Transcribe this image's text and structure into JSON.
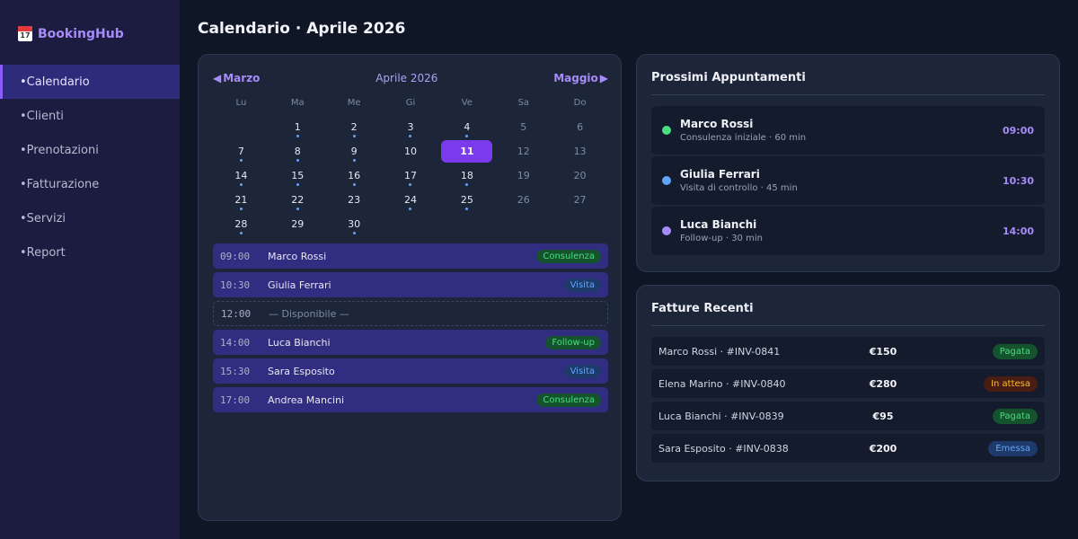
{
  "brand": {
    "name": "BookingHub",
    "icon": "calendar-icon",
    "icon_number": "17"
  },
  "sidebar": {
    "items": [
      {
        "label": "Calendario",
        "active": true
      },
      {
        "label": "Clienti",
        "active": false
      },
      {
        "label": "Prenotazioni",
        "active": false
      },
      {
        "label": "Fatturazione",
        "active": false
      },
      {
        "label": "Servizi",
        "active": false
      },
      {
        "label": "Report",
        "active": false
      }
    ]
  },
  "page": {
    "title": "Calendario · Aprile 2026"
  },
  "calendar": {
    "prev_label": "Marzo",
    "current_label": "Aprile 2026",
    "next_label": "Maggio",
    "weekdays": [
      "Lu",
      "Ma",
      "Me",
      "Gi",
      "Ve",
      "Sa",
      "Do"
    ],
    "today": 11,
    "weeks": [
      [
        null,
        1,
        2,
        3,
        4,
        5,
        6
      ],
      [
        7,
        8,
        9,
        10,
        11,
        12,
        13
      ],
      [
        14,
        15,
        16,
        17,
        18,
        19,
        20
      ],
      [
        21,
        22,
        23,
        24,
        25,
        26,
        27
      ],
      [
        28,
        29,
        30,
        null,
        null,
        null,
        null
      ]
    ],
    "days_with_events": [
      1,
      2,
      3,
      4,
      7,
      8,
      9,
      14,
      15,
      16,
      17,
      18,
      21,
      22,
      24,
      25,
      28,
      30
    ]
  },
  "slots": [
    {
      "time": "09:00",
      "name": "Marco Rossi",
      "tag": "Consulenza",
      "tag_color": "green"
    },
    {
      "time": "10:30",
      "name": "Giulia Ferrari",
      "tag": "Visita",
      "tag_color": "blue"
    },
    {
      "time": "12:00",
      "name": "— Disponibile —",
      "tag": null,
      "free": true
    },
    {
      "time": "14:00",
      "name": "Luca Bianchi",
      "tag": "Follow-up",
      "tag_color": "green"
    },
    {
      "time": "15:30",
      "name": "Sara Esposito",
      "tag": "Visita",
      "tag_color": "blue"
    },
    {
      "time": "17:00",
      "name": "Andrea Mancini",
      "tag": "Consulenza",
      "tag_color": "green"
    }
  ],
  "appointments": {
    "title": "Prossimi Appuntamenti",
    "items": [
      {
        "name": "Marco Rossi",
        "desc": "Consulenza iniziale · 60 min",
        "time": "09:00",
        "dot_color": "#4ade80"
      },
      {
        "name": "Giulia Ferrari",
        "desc": "Visita di controllo · 45 min",
        "time": "10:30",
        "dot_color": "#60a5fa"
      },
      {
        "name": "Luca Bianchi",
        "desc": "Follow-up · 30 min",
        "time": "14:00",
        "dot_color": "#a78bfa"
      }
    ]
  },
  "invoices": {
    "title": "Fatture Recenti",
    "items": [
      {
        "client": "Marco Rossi · #INV-0841",
        "amount": "€150",
        "status": "Pagata",
        "status_type": "paid"
      },
      {
        "client": "Elena Marino · #INV-0840",
        "amount": "€280",
        "status": "In attesa",
        "status_type": "pending"
      },
      {
        "client": "Luca Bianchi · #INV-0839",
        "amount": "€95",
        "status": "Pagata",
        "status_type": "paid"
      },
      {
        "client": "Sara Esposito · #INV-0838",
        "amount": "€200",
        "status": "Emessa",
        "status_type": "issued"
      }
    ]
  }
}
